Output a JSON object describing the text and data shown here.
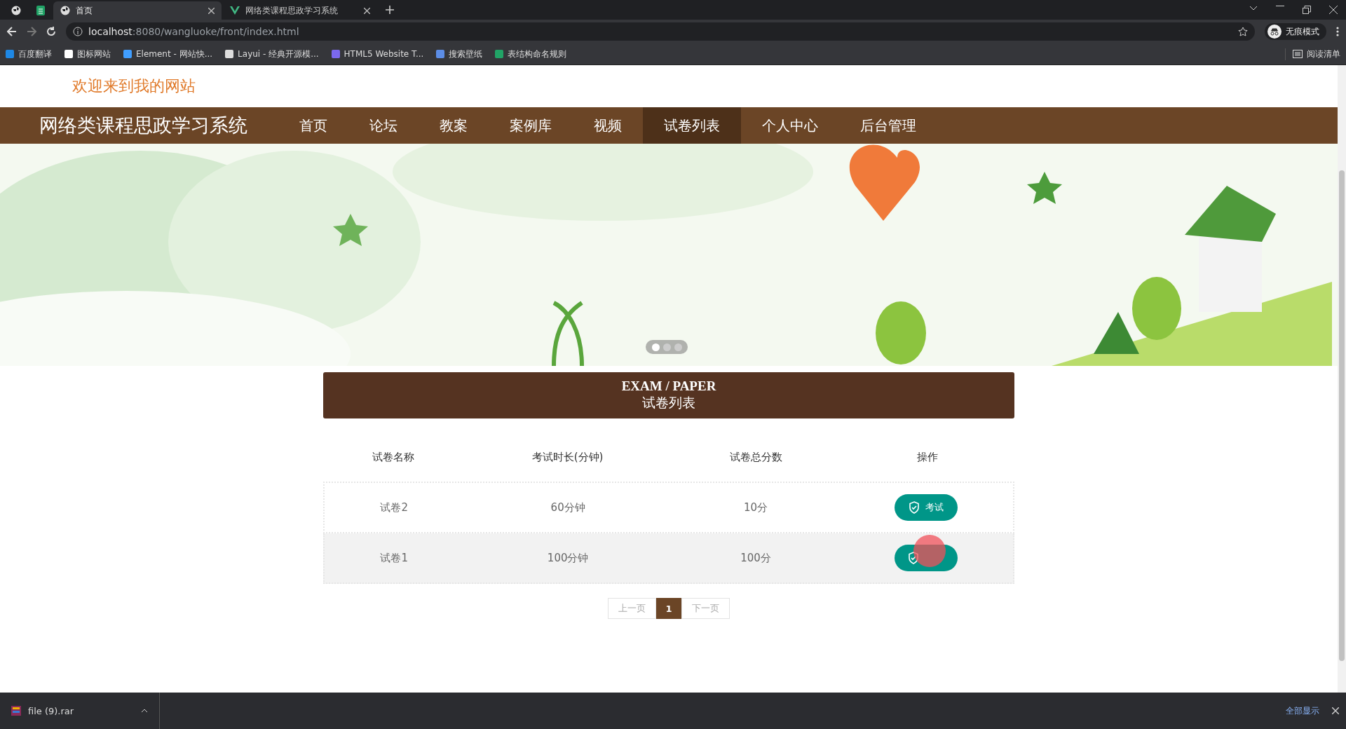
{
  "browser": {
    "tabs": [
      {
        "kind": "pinned",
        "selected": false
      },
      {
        "kind": "pinned-sheet",
        "selected": false
      },
      {
        "kind": "page",
        "title": "首页",
        "selected": true
      },
      {
        "kind": "vue",
        "title": "网络类课程思政学习系统",
        "selected": false
      }
    ],
    "address": {
      "host": "localhost",
      "rest": ":8080/wangluoke/front/index.html"
    },
    "profile": "无痕模式",
    "bookmarks": [
      {
        "label": "百度翻译",
        "color": "#1e88e5"
      },
      {
        "label": "图标网站",
        "color": "#ffffff"
      },
      {
        "label": "Element - 网站快...",
        "color": "#409eff"
      },
      {
        "label": "Layui - 经典开源模...",
        "color": "#dddddd"
      },
      {
        "label": "HTML5 Website T...",
        "color": "#7b68ee"
      },
      {
        "label": "搜索壁纸",
        "color": "#5c8de6"
      },
      {
        "label": "表结构命名规则",
        "color": "#21a366"
      }
    ],
    "reading_list": "阅读清单"
  },
  "site": {
    "welcome": "欢迎来到我的网站",
    "brand": "网络类课程思政学习系统",
    "nav": [
      {
        "label": "首页",
        "selected": false
      },
      {
        "label": "论坛",
        "selected": false
      },
      {
        "label": "教案",
        "selected": false
      },
      {
        "label": "案例库",
        "selected": false
      },
      {
        "label": "视频",
        "selected": false
      },
      {
        "label": "试卷列表",
        "selected": true
      },
      {
        "label": "个人中心",
        "selected": false
      },
      {
        "label": "后台管理",
        "selected": false
      }
    ],
    "carousel": {
      "dots": [
        {
          "selected": true
        },
        {
          "selected": false
        },
        {
          "selected": false
        }
      ]
    },
    "section": {
      "title_en": "EXAM / PAPER",
      "title": "试卷列表"
    },
    "table": {
      "columns": [
        "试卷名称",
        "考试时长(分钟)",
        "试卷总分数",
        "操作"
      ],
      "rows": [
        {
          "name": "试卷2",
          "duration": "60分钟",
          "score": "10分",
          "action": "考试",
          "cursor": false
        },
        {
          "name": "试卷1",
          "duration": "100分钟",
          "score": "100分",
          "cursor": true
        }
      ]
    },
    "pagination": {
      "prev": "上一页",
      "pages": [
        {
          "label": "1",
          "selected": true
        }
      ],
      "next": "下一页"
    }
  },
  "downloads": {
    "file": "file (9).rar",
    "show_all": "全部显示"
  }
}
